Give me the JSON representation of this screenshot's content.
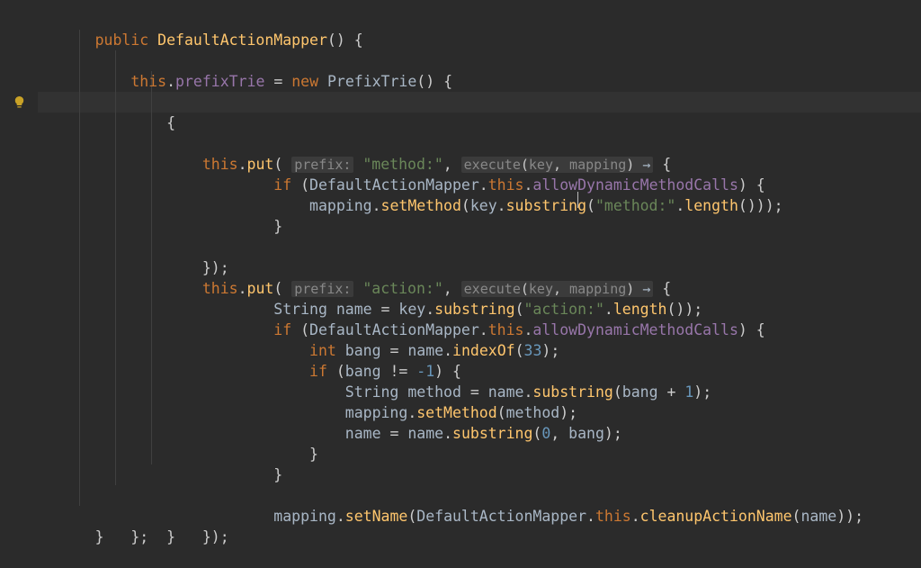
{
  "t": {
    "public": "public",
    "ctor": "DefaultActionMapper",
    "this": "this",
    "prefixTrie": "prefixTrie",
    "new": "new",
    "PrefixTrie": "PrefixTrie",
    "put": "put",
    "prefixHint": "prefix:",
    "methodStr": "\"method:\"",
    "actionStr": "\"action:\"",
    "execHint": "execute",
    "key": "key",
    "mapping": "mapping",
    "if": "if",
    "DAM": "DefaultActionMapper",
    "allowDMC": "allowDynamicMethodCalls",
    "setMethod": "setMethod",
    "substring": "substring",
    "length": "length",
    "String": "String",
    "name": "name",
    "int": "int",
    "bang": "bang",
    "indexOf": "indexOf",
    "n33": "33",
    "nm1": "-1",
    "n1": "1",
    "n0": "0",
    "method": "method",
    "setName": "setName",
    "cleanupActionName": "cleanupActionName"
  }
}
